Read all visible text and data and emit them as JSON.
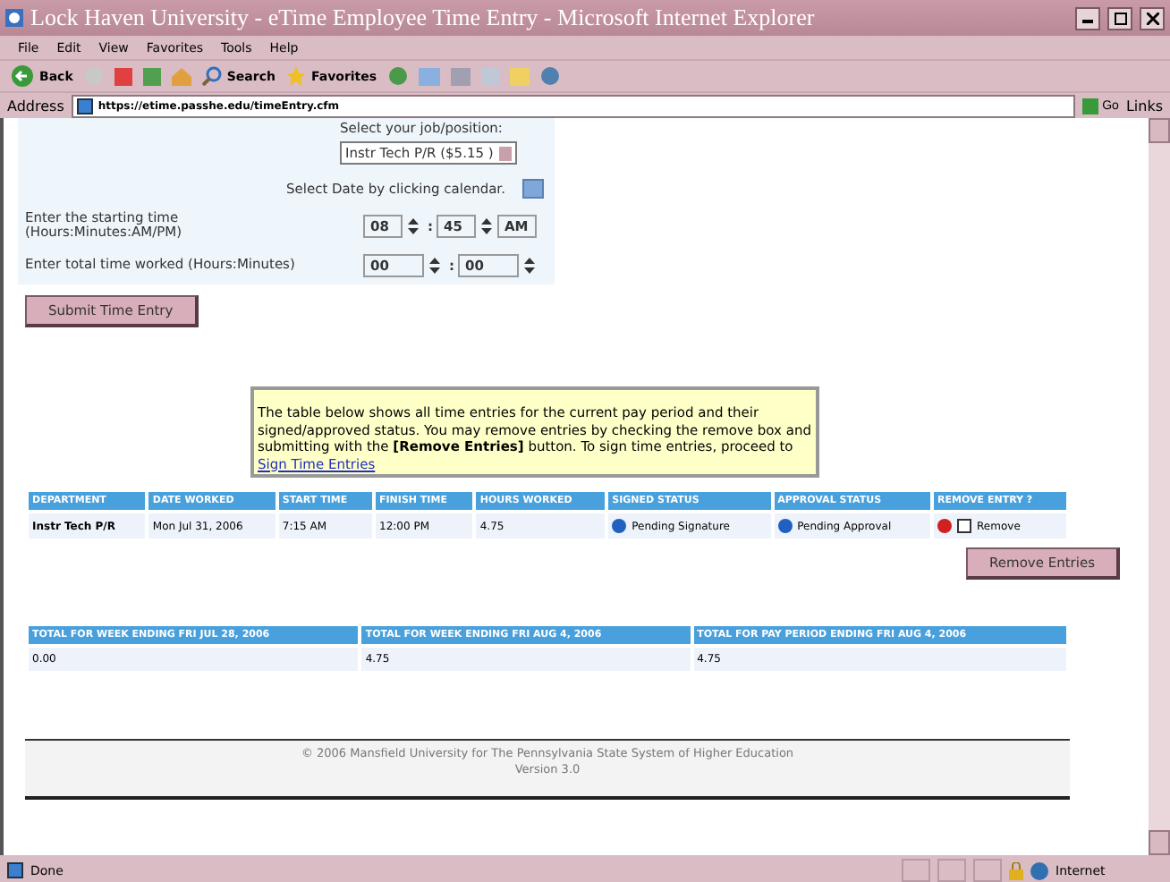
{
  "window": {
    "title": "Lock Haven University - eTime Employee Time Entry - Microsoft Internet Explorer"
  },
  "menu": [
    "File",
    "Edit",
    "View",
    "Favorites",
    "Tools",
    "Help"
  ],
  "toolbar": {
    "back": "Back",
    "search": "Search",
    "favorites": "Favorites"
  },
  "address_bar": {
    "label": "Address",
    "url": "https://etime.passhe.edu/timeEntry.cfm",
    "go": "Go",
    "links": "Links"
  },
  "form": {
    "job_prompt": "Select your job/position:",
    "job": "Instr Tech P/R ($5.15 )",
    "date_prompt": "Select Date by clicking calendar.",
    "start_label": "Enter the starting time",
    "start_hint": "(Hours:Minutes:AM/PM)",
    "start_hour": "08",
    "start_minute": "45",
    "start_ampm": "AM",
    "total_label": "Enter total time worked (Hours:Minutes)",
    "total_hours": "00",
    "total_minutes": "00",
    "separator": ":",
    "submit": "Submit Time Entry"
  },
  "notice": {
    "text": "The table below shows all time entries for the current pay period and their signed/approved status. You may remove entries by checking the remove box and submitting with the **[Remove Entries]** button. To sign time entries, proceed to",
    "link": "Sign Time Entries"
  },
  "entries": {
    "columns": [
      "DEPARTMENT",
      "DATE WORKED",
      "START TIME",
      "FINISH TIME",
      "HOURS WORKED",
      "SIGNED STATUS",
      "APPROVAL STATUS",
      "REMOVE ENTRY ?"
    ],
    "rows": [
      {
        "department": "Instr Tech P/R",
        "date": "Mon Jul 31, 2006",
        "start": "7:15 AM",
        "finish": "12:00 PM",
        "hours": "4.75",
        "signed": "Pending Signature",
        "approval": "Pending Approval",
        "remove_label": "Remove",
        "checked": false
      }
    ]
  },
  "remove_button": "Remove Entries",
  "totals": {
    "columns": [
      "TOTAL FOR WEEK ENDING FRI JUL 28, 2006",
      "TOTAL FOR WEEK ENDING FRI AUG 4, 2006",
      "TOTAL FOR PAY PERIOD ENDING FRI AUG 4, 2006"
    ],
    "values": [
      "0.00",
      "4.75",
      "4.75"
    ]
  },
  "footer": [
    "© 2006 Mansfield University for The Pennsylvania State System of Higher Education",
    "Version 3.0"
  ],
  "status_bar": {
    "text": "Done",
    "zone": "Internet"
  }
}
